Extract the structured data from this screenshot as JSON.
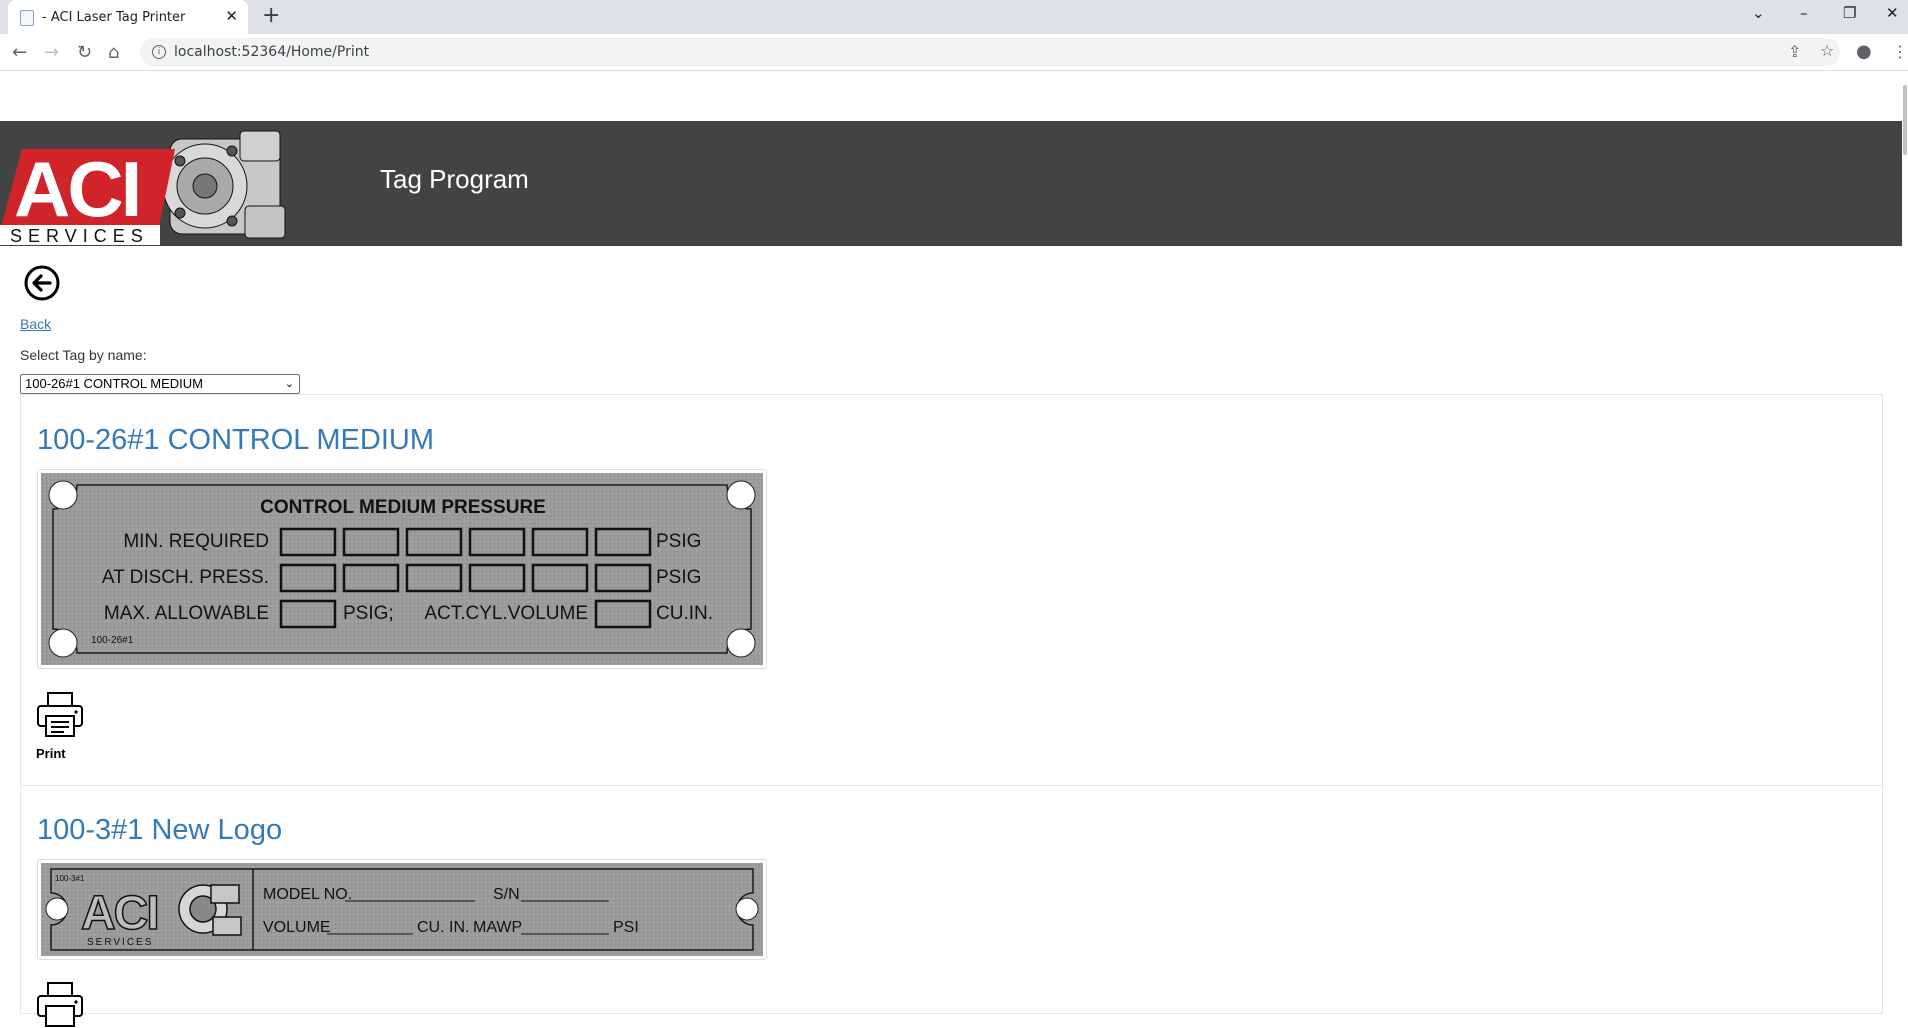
{
  "browser": {
    "tab_title": "- ACI Laser Tag Printer",
    "tab_close": "✕",
    "new_tab": "+",
    "url": "localhost:52364/Home/Print",
    "window_controls": {
      "dropdown": "⌄",
      "minimize": "–",
      "restore": "❐",
      "close": "✕"
    },
    "nav": {
      "back": "←",
      "forward": "→",
      "reload": "↻",
      "home": "⌂"
    },
    "right_icons": {
      "share": "⇪",
      "bookmark": "☆",
      "profile": "●",
      "menu": "⋮"
    }
  },
  "header": {
    "logo_text": "ACI",
    "logo_subtext": "SERVICES",
    "title": "Tag Program"
  },
  "back": {
    "label": "Back"
  },
  "select": {
    "label": "Select Tag by name:",
    "value": "100-26#1 CONTROL MEDIUM",
    "chevron": "⌄"
  },
  "tags": [
    {
      "title": "100-26#1 CONTROL MEDIUM",
      "plate": {
        "heading": "CONTROL MEDIUM PRESSURE",
        "row1_label": "MIN. REQUIRED",
        "row2_label": "AT DISCH. PRESS.",
        "row3_label": "MAX. ALLOWABLE",
        "unit_psig": "PSIG",
        "unit_psig_semicolon": "PSIG;",
        "act_label": "ACT.CYL.VOLUME",
        "unit_cuin": "CU.IN.",
        "code": "100-26#1"
      },
      "print_label": "Print"
    },
    {
      "title": "100-3#1 New Logo",
      "plate": {
        "code": "100-3#1",
        "logo_text": "ACI",
        "logo_subtext": "SERVICES",
        "model_label": "MODEL NO.",
        "sn_label": "S/N",
        "volume_label": "VOLUME",
        "cuin_label": "CU. IN.",
        "mawp_label": "MAWP",
        "psi_label": "PSI"
      }
    }
  ],
  "colors": {
    "header_band": "#424345",
    "logo_red": "#d0232a",
    "link_blue": "#337ab7",
    "plate_gray": "#9a9a9a"
  }
}
